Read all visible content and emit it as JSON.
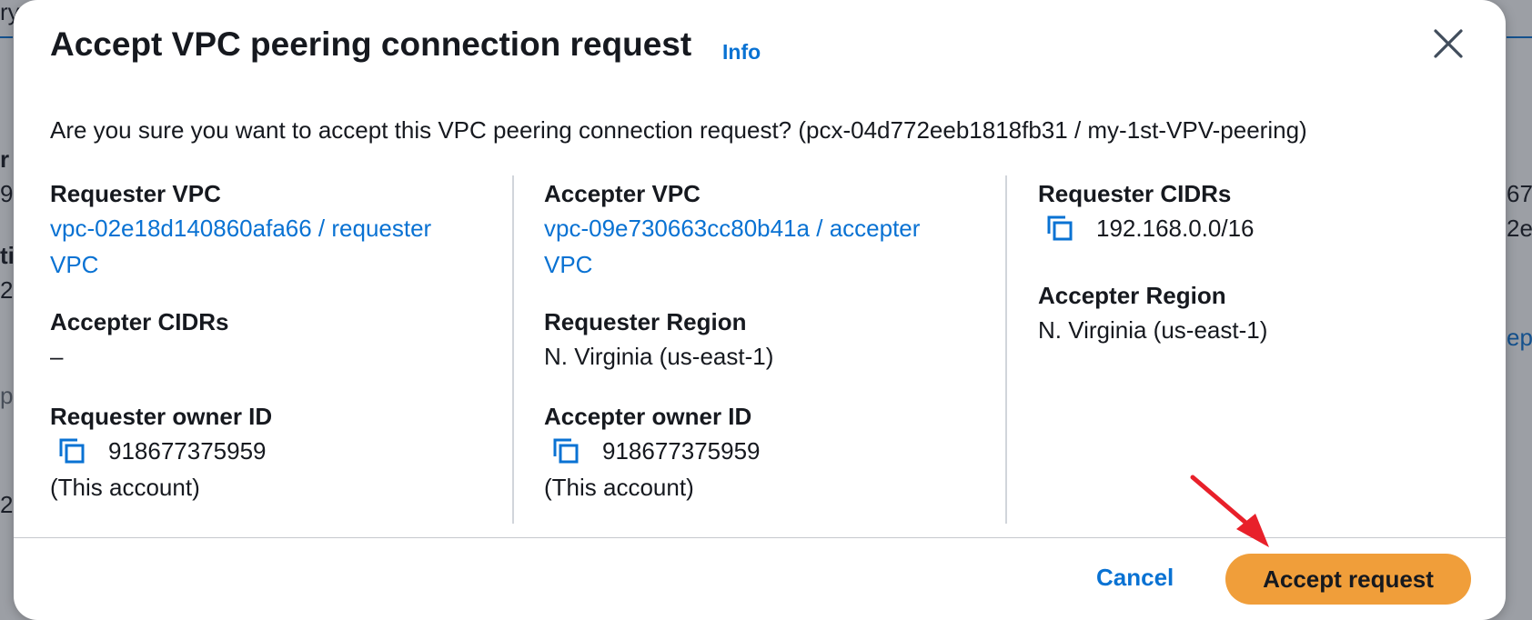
{
  "background": {
    "fragments": [
      "ry",
      "r",
      "9",
      "ti",
      "2e",
      "p",
      "2",
      "67",
      "2e",
      "ep"
    ]
  },
  "modal": {
    "title": "Accept VPC peering connection request",
    "info_label": "Info",
    "question": "Are you sure you want to accept this VPC peering connection request? (pcx-04d772eeb1818fb31 / my-1st-VPV-peering)",
    "columns": [
      {
        "fields": [
          {
            "label": "Requester VPC",
            "value_line1": "vpc-02e18d140860afa66 / requester",
            "value_line2": "VPC"
          },
          {
            "label": "Accepter CIDRs",
            "value": "–"
          },
          {
            "label": "Requester owner ID",
            "value": "918677375959",
            "note": "(This account)"
          }
        ]
      },
      {
        "fields": [
          {
            "label": "Accepter VPC",
            "value_line1": "vpc-09e730663cc80b41a / accepter",
            "value_line2": "VPC"
          },
          {
            "label": "Requester Region",
            "value": "N. Virginia (us-east-1)"
          },
          {
            "label": "Accepter owner ID",
            "value": "918677375959",
            "note": "(This account)"
          }
        ]
      },
      {
        "fields": [
          {
            "label": "Requester CIDRs",
            "value": "192.168.0.0/16"
          },
          {
            "label": "Accepter Region",
            "value": "N. Virginia (us-east-1)"
          }
        ]
      }
    ],
    "cancel_label": "Cancel",
    "accept_label": "Accept request"
  },
  "colors": {
    "link": "#0972d3",
    "primary_button": "#f09e3a",
    "annotation_arrow": "#e8202a"
  },
  "icons": [
    "close-icon",
    "copy-icon",
    "annotation-arrow"
  ]
}
